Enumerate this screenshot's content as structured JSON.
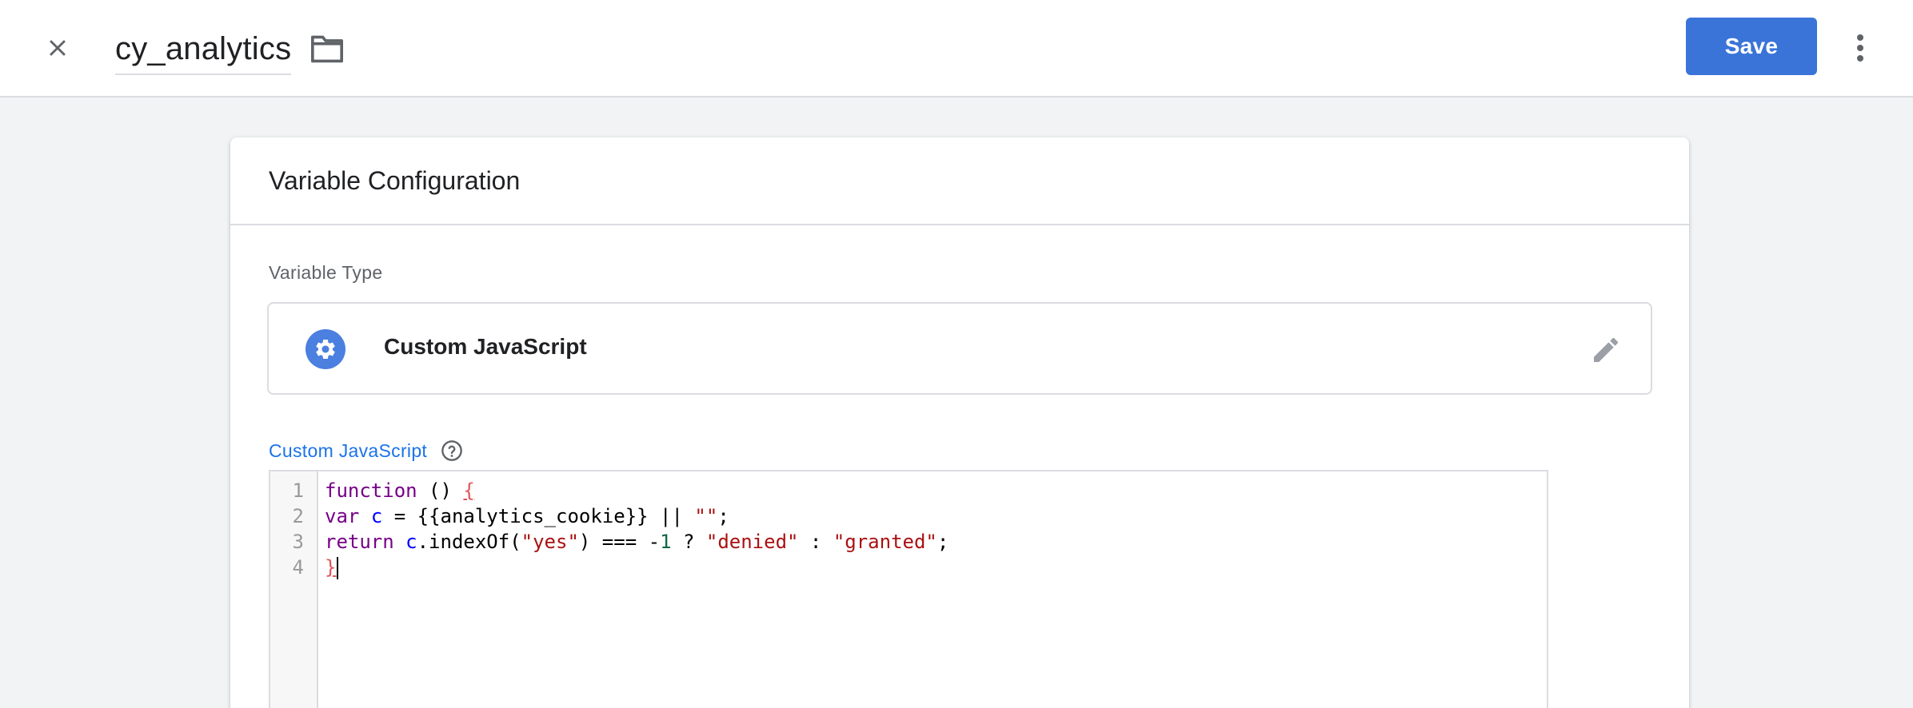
{
  "topbar": {
    "title": "cy_analytics",
    "save_label": "Save"
  },
  "card": {
    "title": "Variable Configuration",
    "variable_type_label": "Variable Type",
    "variable_type_name": "Custom JavaScript",
    "code_label": "Custom JavaScript"
  },
  "editor": {
    "line_numbers": [
      "1",
      "2",
      "3",
      "4"
    ],
    "lines": [
      [
        {
          "t": "function",
          "c": "kw"
        },
        {
          "t": " () ",
          "c": ""
        },
        {
          "t": "{",
          "c": "brace"
        }
      ],
      [
        {
          "t": "var",
          "c": "kw"
        },
        {
          "t": " ",
          "c": ""
        },
        {
          "t": "c",
          "c": "var"
        },
        {
          "t": " = {{analytics_cookie}} || ",
          "c": ""
        },
        {
          "t": "\"\"",
          "c": "str"
        },
        {
          "t": ";",
          "c": ""
        }
      ],
      [
        {
          "t": "return",
          "c": "kw"
        },
        {
          "t": " ",
          "c": ""
        },
        {
          "t": "c",
          "c": "var"
        },
        {
          "t": ".indexOf(",
          "c": ""
        },
        {
          "t": "\"yes\"",
          "c": "str"
        },
        {
          "t": ") === -",
          "c": ""
        },
        {
          "t": "1",
          "c": "num"
        },
        {
          "t": " ? ",
          "c": ""
        },
        {
          "t": "\"denied\"",
          "c": "str"
        },
        {
          "t": " : ",
          "c": ""
        },
        {
          "t": "\"granted\"",
          "c": "str"
        },
        {
          "t": ";",
          "c": ""
        }
      ],
      [
        {
          "t": "}",
          "c": "brace"
        }
      ]
    ]
  },
  "icons": {
    "close": "close-icon",
    "folder": "folder-icon",
    "more": "more-vert-icon",
    "type": "gear-icon",
    "edit": "pencil-icon",
    "help": "help-icon"
  },
  "colors": {
    "accent": "#3a74d9",
    "link": "#1a73e8",
    "type_icon_bg": "#4b7fe0"
  }
}
